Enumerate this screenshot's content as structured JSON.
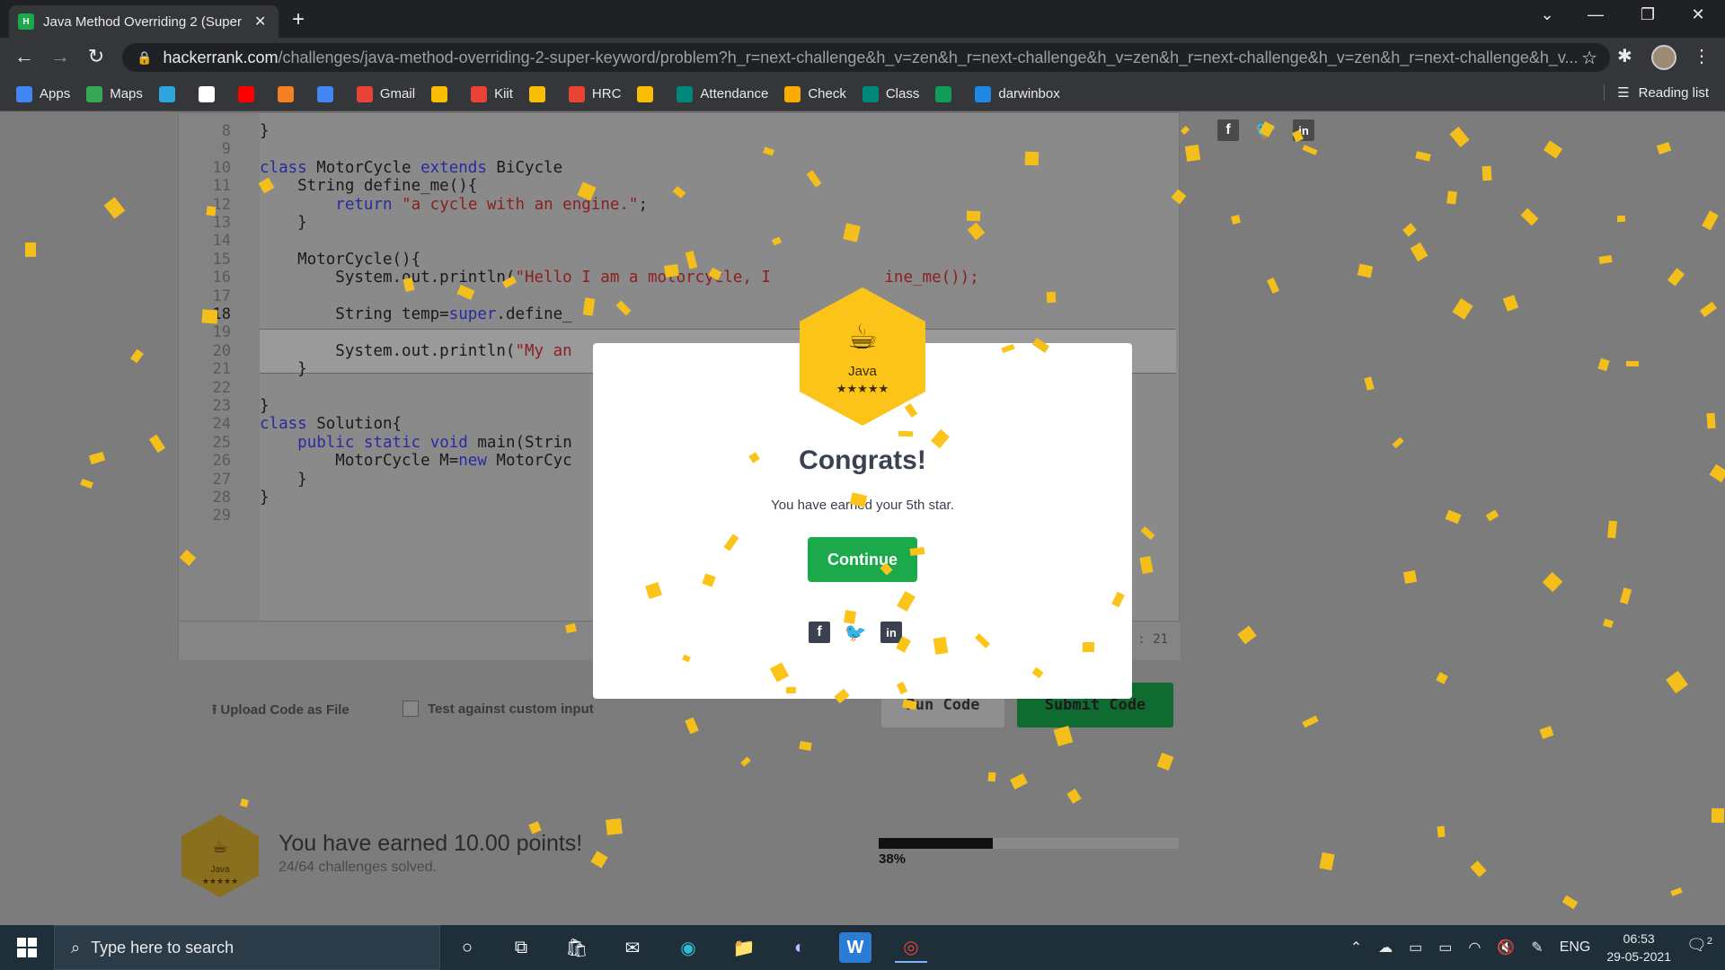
{
  "browser": {
    "tab_title": "Java Method Overriding 2 (Super",
    "tab_favicon_text": "H",
    "url_host": "hackerrank.com",
    "url_path": "/challenges/java-method-overriding-2-super-keyword/problem?h_r=next-challenge&h_v=zen&h_r=next-challenge&h_v=zen&h_r=next-challenge&h_v=zen&h_r=next-challenge&h_v...",
    "bookmarks": [
      {
        "label": "Apps",
        "icon_color": "#4285f4",
        "icon": "apps-grid-icon"
      },
      {
        "label": "Maps",
        "icon_color": "#34a853",
        "icon": "maps-icon"
      },
      {
        "label": "",
        "icon_color": "#2ca5e0",
        "icon": "telegram-icon"
      },
      {
        "label": "",
        "icon_color": "#ffffff",
        "icon": "github-icon"
      },
      {
        "label": "",
        "icon_color": "#ff0000",
        "icon": "youtube-icon"
      },
      {
        "label": "",
        "icon_color": "#f48024",
        "icon": "in-icon"
      },
      {
        "label": "",
        "icon_color": "#4285f4",
        "icon": "external-icon"
      },
      {
        "label": "Gmail",
        "icon_color": "#ea4335",
        "icon": "gmail-icon"
      },
      {
        "label": "",
        "icon_color": "#fbbc04",
        "icon": "drive-icon"
      },
      {
        "label": "Kiit",
        "icon_color": "#ea4335",
        "icon": "gmail-icon"
      },
      {
        "label": "",
        "icon_color": "#fbbc04",
        "icon": "drive-icon"
      },
      {
        "label": "HRC",
        "icon_color": "#ea4335",
        "icon": "gmail-icon"
      },
      {
        "label": "",
        "icon_color": "#fbbc04",
        "icon": "drive-icon"
      },
      {
        "label": "Attendance",
        "icon_color": "#00897b",
        "icon": "meet-icon"
      },
      {
        "label": "Check",
        "icon_color": "#f9ab00",
        "icon": "check-icon"
      },
      {
        "label": "Class",
        "icon_color": "#00897b",
        "icon": "meet-icon"
      },
      {
        "label": "",
        "icon_color": "#0f9d58",
        "icon": "sheets-icon"
      },
      {
        "label": "darwinbox",
        "icon_color": "#1e88e5",
        "icon": "darwinbox-icon"
      }
    ],
    "reading_list": "Reading list"
  },
  "editor": {
    "lines": [
      {
        "num": "8",
        "code": "}"
      },
      {
        "num": "9",
        "code": ""
      },
      {
        "num": "10",
        "code": "class MotorCycle extends BiCycle"
      },
      {
        "num": "11",
        "code": "    String define_me(){"
      },
      {
        "num": "12",
        "code": "        return \"a cycle with an engine.\";"
      },
      {
        "num": "13",
        "code": "    }"
      },
      {
        "num": "14",
        "code": ""
      },
      {
        "num": "15",
        "code": "    MotorCycle(){"
      },
      {
        "num": "16",
        "code": "        System.out.println(\"Hello I am a motorcycle, I            ine_me());"
      },
      {
        "num": "17",
        "code": ""
      },
      {
        "num": "18",
        "code": "        String temp=super.define_"
      },
      {
        "num": "19",
        "code": ""
      },
      {
        "num": "20",
        "code": "        System.out.println(\"My an"
      },
      {
        "num": "21",
        "code": "    }"
      },
      {
        "num": "22",
        "code": ""
      },
      {
        "num": "23",
        "code": "}"
      },
      {
        "num": "24",
        "code": "class Solution{"
      },
      {
        "num": "25",
        "code": "    public static void main(Strin"
      },
      {
        "num": "26",
        "code": "        MotorCycle M=new MotorCyc"
      },
      {
        "num": "27",
        "code": "    }"
      },
      {
        "num": "28",
        "code": "}"
      },
      {
        "num": "29",
        "code": ""
      }
    ],
    "col_info": ": 21"
  },
  "actions": {
    "upload_label": "Upload Code as File",
    "custom_input_label": "Test against custom input",
    "run_label": "Run Code",
    "submit_label": "Submit Code"
  },
  "progress": {
    "points_text": "You have earned 10.00 points!",
    "solved_text": "24/64 challenges solved.",
    "percent_label": "38%",
    "fraction": 0.38
  },
  "modal": {
    "badge_title": "Java",
    "badge_stars": "★★★★★",
    "heading": "Congrats!",
    "message": "You have earned your 5th star.",
    "continue_label": "Continue"
  },
  "taskbar": {
    "search_placeholder": "Type here to search",
    "language": "ENG",
    "time": "06:53",
    "date": "29-05-2021",
    "notification_count": "2"
  },
  "colors": {
    "accent_green": "#1ba94c",
    "confetti": "#fcc419",
    "badge_gold": "#fcc419"
  }
}
